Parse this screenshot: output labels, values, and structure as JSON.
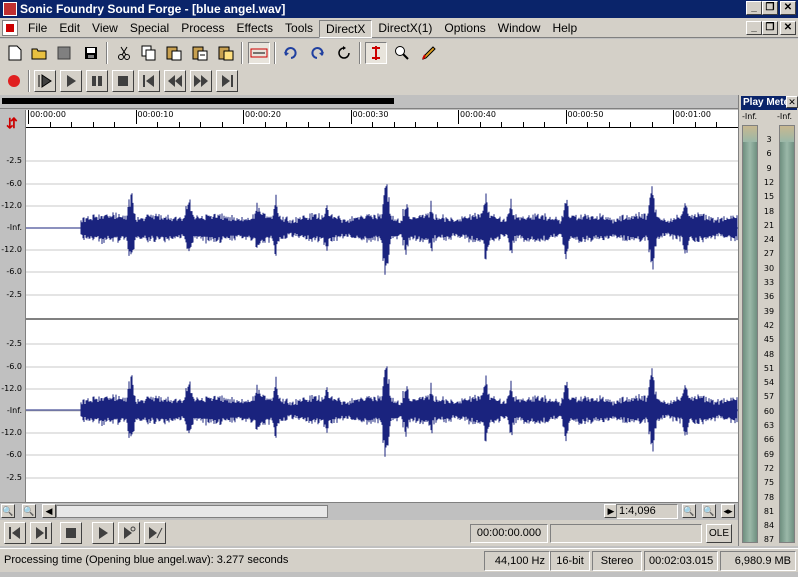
{
  "window": {
    "title": "Sonic Foundry Sound Forge - [blue angel.wav]",
    "btn_min": "_",
    "btn_restore": "❐",
    "btn_close": "✕"
  },
  "menu": {
    "items": [
      "File",
      "Edit",
      "View",
      "Special",
      "Process",
      "Effects",
      "Tools",
      "DirectX",
      "DirectX(1)",
      "Options",
      "Window",
      "Help"
    ],
    "active": "DirectX"
  },
  "toolbar": {
    "icons": [
      "new-icon",
      "open-icon",
      "close-file-icon",
      "save-icon",
      "cut-icon",
      "copy-icon",
      "paste-icon",
      "paste-new-icon",
      "mix-icon",
      "trim-icon",
      "undo-icon",
      "redo-icon",
      "repeat-icon",
      "edit-tool-icon",
      "magnify-tool-icon",
      "pencil-tool-icon"
    ]
  },
  "transport": {
    "icons": [
      "record-icon",
      "play-all-icon",
      "play-icon",
      "pause-icon",
      "stop-icon",
      "go-to-start-icon",
      "rewind-icon",
      "fast-forward-icon",
      "go-to-end-icon"
    ]
  },
  "ruler": {
    "ticks": [
      "00:00:00",
      "00:00:10",
      "00:00:20",
      "00:00:30",
      "00:00:40",
      "00:00:50",
      "00:01:00"
    ]
  },
  "scale": {
    "labels": [
      "-2.5",
      "-6.0",
      "-12.0",
      "-Inf.",
      "-12.0",
      "-6.0",
      "-2.5"
    ]
  },
  "wave_bottom": {
    "ratio": "1:4,096",
    "time": "00:00:00.000",
    "ole": "OLE"
  },
  "meter": {
    "title": "Play Meter",
    "inf_left": "-Inf.",
    "inf_right": "-Inf.",
    "labels": [
      "3",
      "6",
      "9",
      "12",
      "15",
      "18",
      "21",
      "24",
      "27",
      "30",
      "33",
      "36",
      "39",
      "42",
      "45",
      "48",
      "51",
      "54",
      "57",
      "60",
      "63",
      "66",
      "69",
      "72",
      "75",
      "78",
      "81",
      "84",
      "87"
    ]
  },
  "status": {
    "message": "Processing time (Opening blue angel.wav): 3.277 seconds",
    "sample_rate": "44,100 Hz",
    "bit_depth": "16-bit",
    "channels": "Stereo",
    "length": "00:02:03.015",
    "free_space": "6,980.9 MB"
  },
  "colors": {
    "waveform": "#1a237e",
    "titlebar": "#0a246a",
    "record": "#e02020"
  }
}
